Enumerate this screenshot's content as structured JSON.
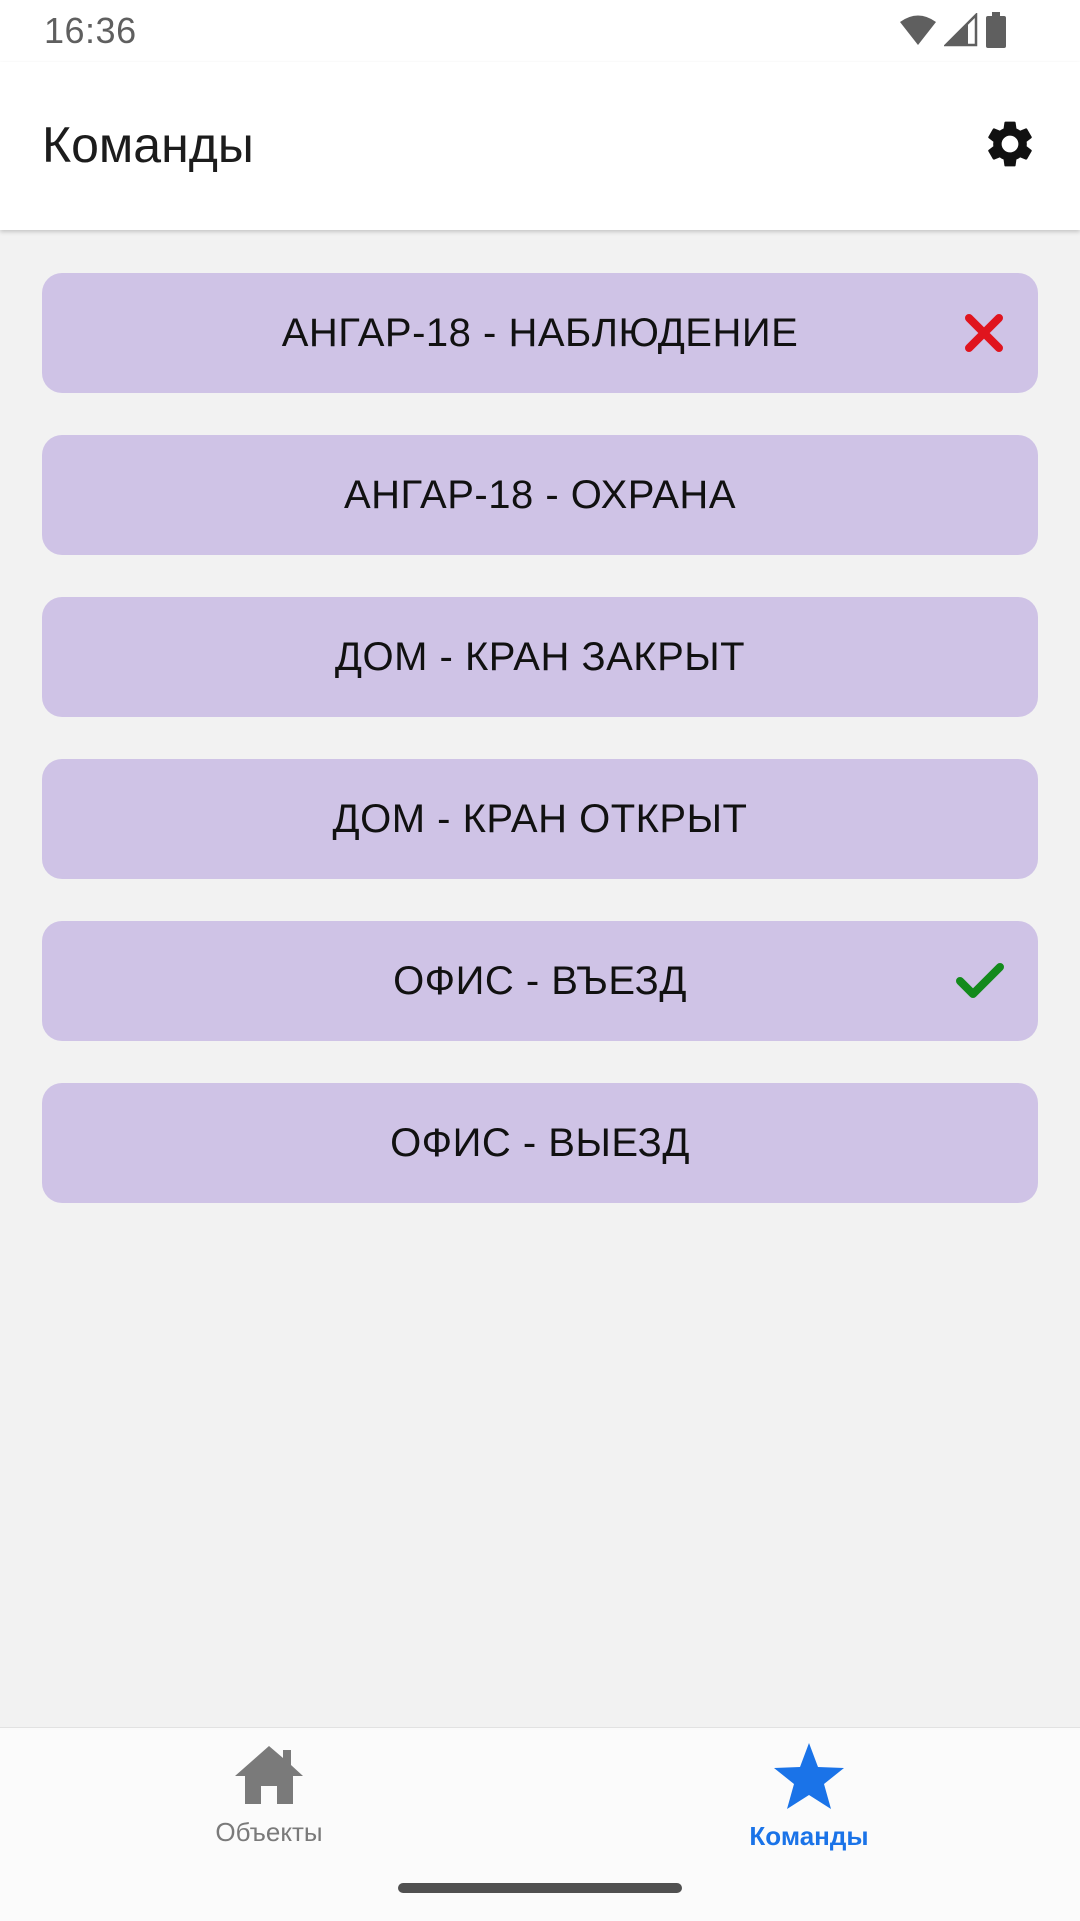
{
  "status_bar": {
    "time": "16:36"
  },
  "header": {
    "title": "Команды",
    "settings_icon": "gear-icon"
  },
  "commands": [
    {
      "label": "АНГАР-18 - НАБЛЮДЕНИЕ",
      "status": "error"
    },
    {
      "label": "АНГАР-18 - ОХРАНА",
      "status": ""
    },
    {
      "label": "ДОМ - КРАН ЗАКРЫТ",
      "status": ""
    },
    {
      "label": "ДОМ - КРАН ОТКРЫТ",
      "status": ""
    },
    {
      "label": "ОФИС - ВЪЕЗД",
      "status": "success"
    },
    {
      "label": "ОФИС - ВЫЕЗД",
      "status": ""
    }
  ],
  "bottom_nav": {
    "items": [
      {
        "label": "Объекты",
        "icon": "home-icon",
        "active": false
      },
      {
        "label": "Команды",
        "icon": "star-icon",
        "active": true
      }
    ]
  },
  "colors": {
    "command_bg": "#cfc3e6",
    "active_tab": "#1a73e8",
    "inactive_tab": "#7a7a7a",
    "error_mark": "#e0141e",
    "success_mark": "#138a1c"
  }
}
